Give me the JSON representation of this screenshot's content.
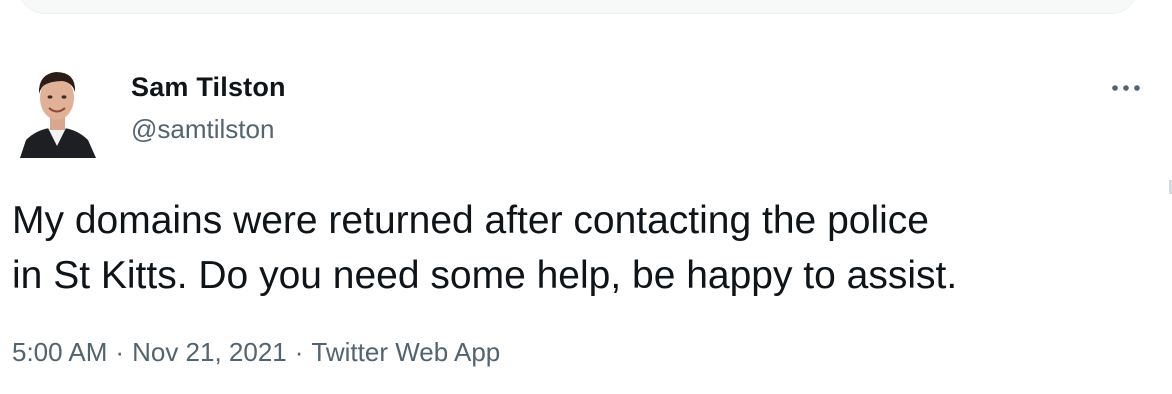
{
  "tweet": {
    "author": {
      "display_name": "Sam Tilston",
      "handle": "@samtilston",
      "avatar_icon": "profile-photo"
    },
    "more_icon": "more-options-icon",
    "text_line1": "My domains were returned after contacting the police",
    "text_line2": "in St Kitts. Do you need some help, be happy to assist.",
    "time": "5:00 AM",
    "separator": "·",
    "date": "Nov 21, 2021",
    "source": "Twitter Web App"
  },
  "colors": {
    "text_primary": "#0f1419",
    "text_secondary": "#536471",
    "background": "#ffffff"
  }
}
